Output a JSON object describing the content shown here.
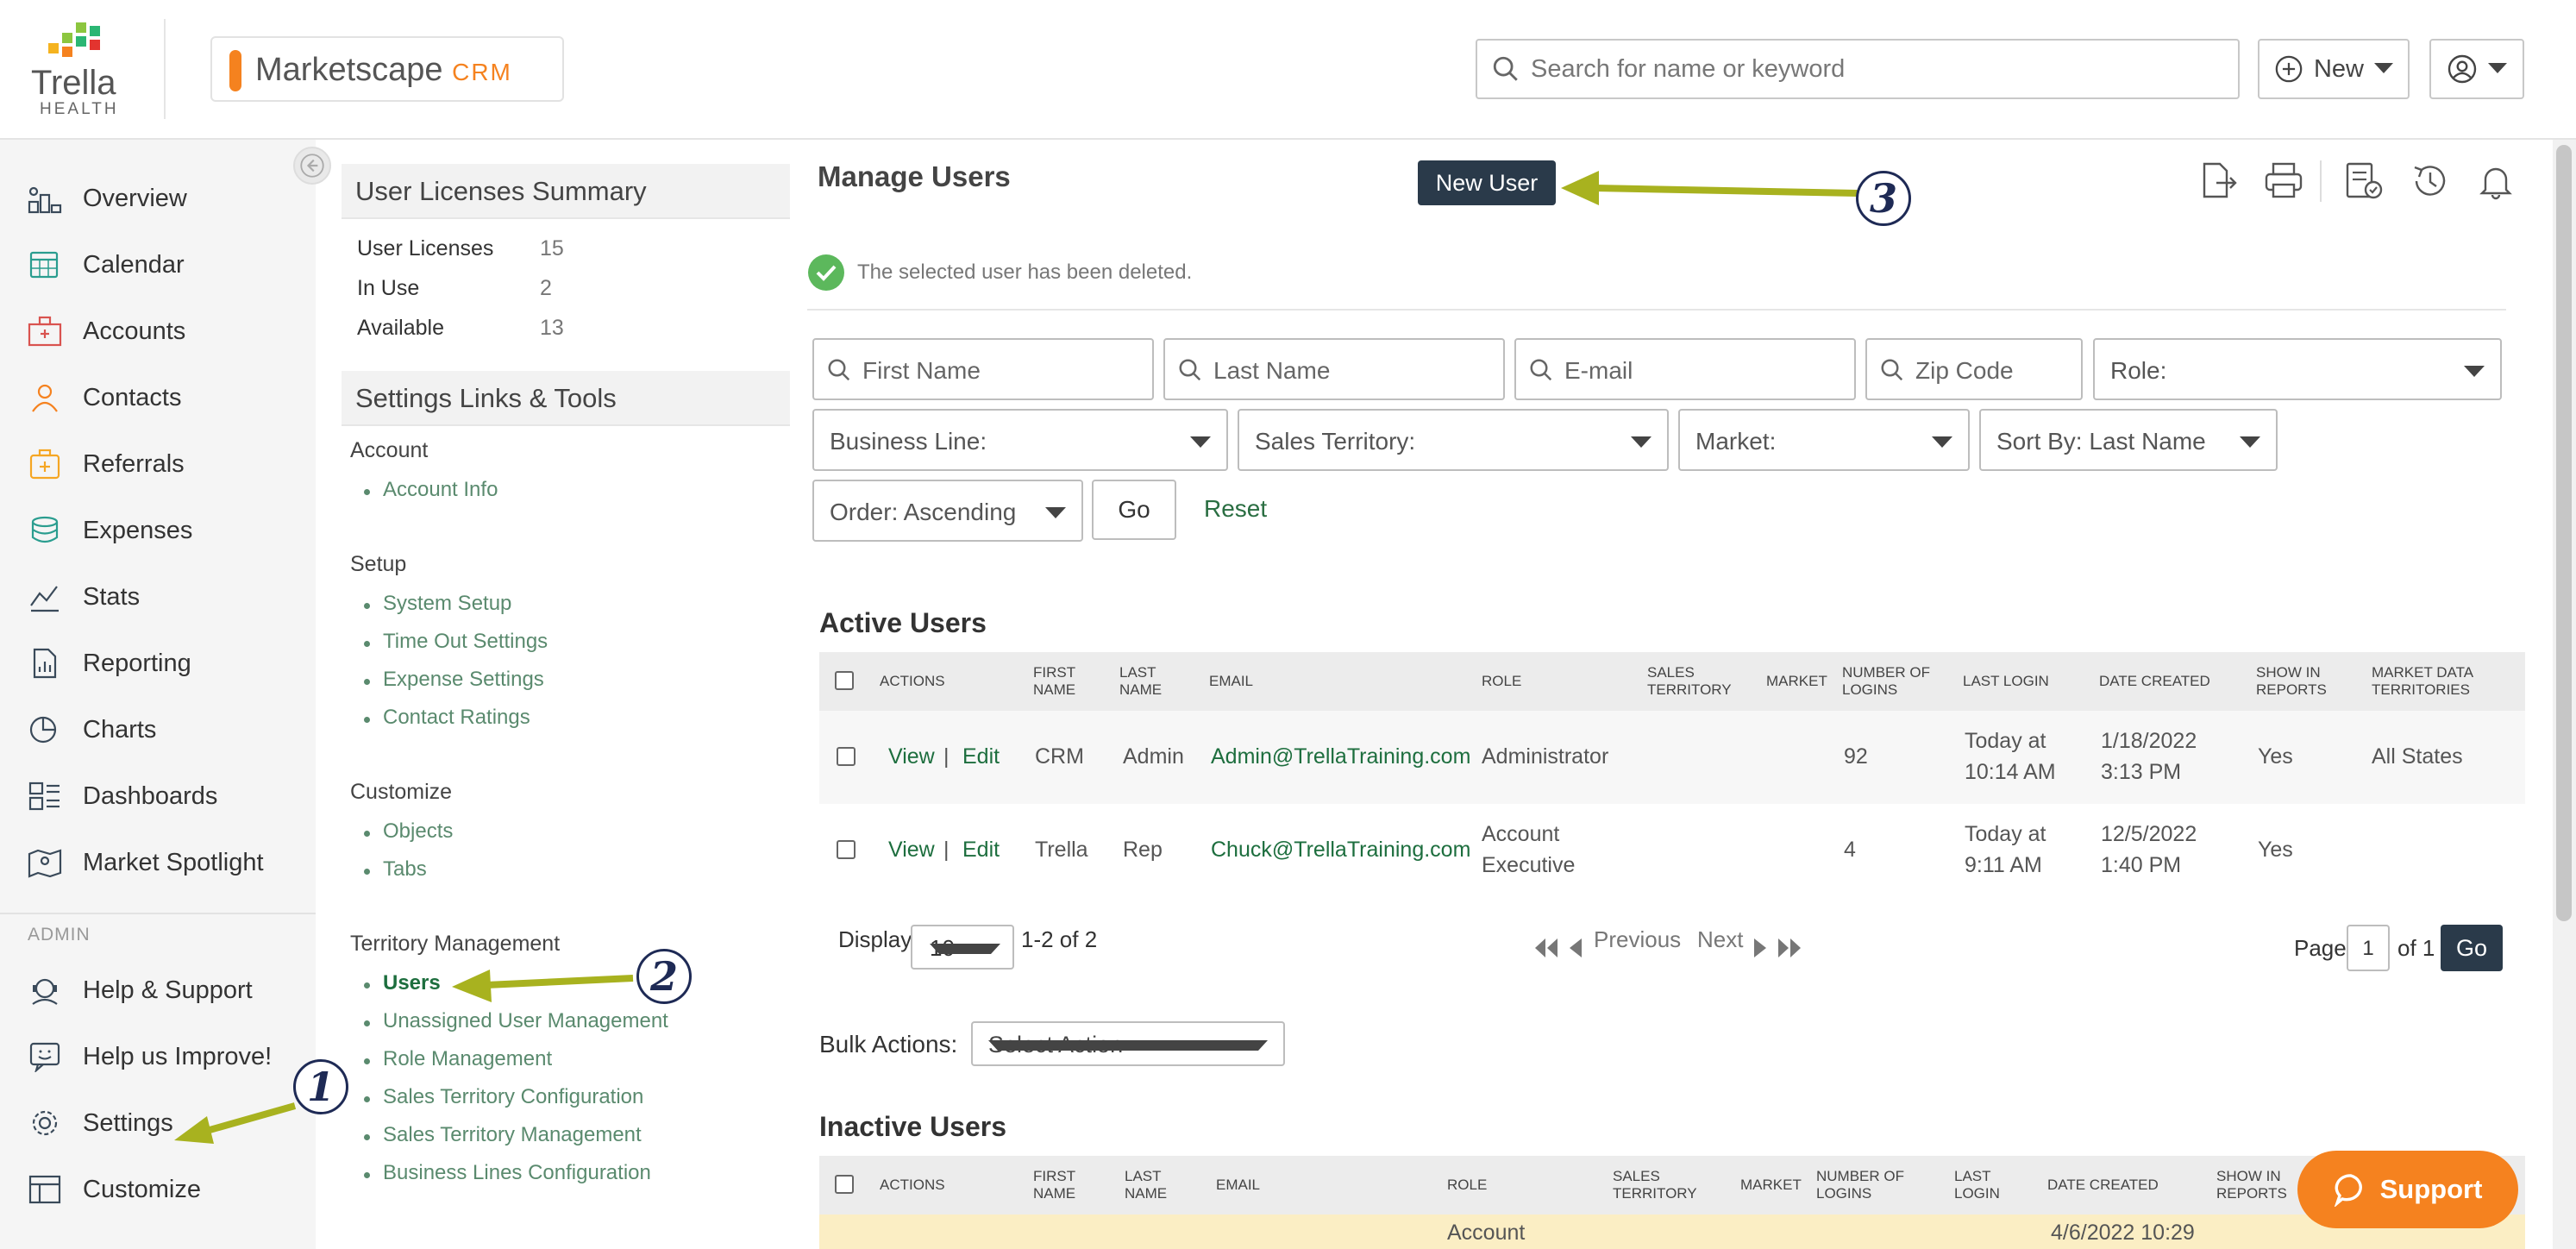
{
  "brand": {
    "logo_name": "Trella",
    "logo_sub": "HEALTH",
    "product": "Marketscape",
    "product_suffix": "CRM",
    "colors": {
      "accent": "#f5821f",
      "link": "#1d6e3e",
      "dark_button": "#2a3a4a"
    }
  },
  "header": {
    "search_placeholder": "Search for name or keyword",
    "new_label": "New"
  },
  "sidebar": {
    "items": [
      {
        "label": "Overview",
        "icon": "overview-icon"
      },
      {
        "label": "Calendar",
        "icon": "calendar-icon"
      },
      {
        "label": "Accounts",
        "icon": "accounts-icon"
      },
      {
        "label": "Contacts",
        "icon": "contacts-icon"
      },
      {
        "label": "Referrals",
        "icon": "referrals-icon"
      },
      {
        "label": "Expenses",
        "icon": "expenses-icon"
      },
      {
        "label": "Stats",
        "icon": "stats-icon"
      },
      {
        "label": "Reporting",
        "icon": "reporting-icon"
      },
      {
        "label": "Charts",
        "icon": "charts-icon"
      },
      {
        "label": "Dashboards",
        "icon": "dashboards-icon"
      },
      {
        "label": "Market Spotlight",
        "icon": "map-icon"
      }
    ],
    "admin_label": "ADMIN",
    "admin_items": [
      {
        "label": "Help & Support",
        "icon": "headset-icon"
      },
      {
        "label": "Help us Improve!",
        "icon": "feedback-icon"
      },
      {
        "label": "Settings",
        "icon": "gear-icon"
      },
      {
        "label": "Customize",
        "icon": "layout-icon"
      }
    ]
  },
  "licenses": {
    "title": "User Licenses Summary",
    "rows": [
      {
        "label": "User Licenses",
        "value": "15"
      },
      {
        "label": "In Use",
        "value": "2"
      },
      {
        "label": "Available",
        "value": "13"
      }
    ]
  },
  "settings_links": {
    "title": "Settings Links & Tools",
    "sections": [
      {
        "title": "Account",
        "links": [
          "Account Info"
        ]
      },
      {
        "title": "Setup",
        "links": [
          "System Setup",
          "Time Out Settings",
          "Expense Settings",
          "Contact Ratings"
        ]
      },
      {
        "title": "Customize",
        "links": [
          "Objects",
          "Tabs"
        ]
      },
      {
        "title": "Territory Management",
        "links": [
          "Users",
          "Unassigned User Management",
          "Role Management",
          "Sales Territory Configuration",
          "Sales Territory Management",
          "Business Lines Configuration"
        ]
      }
    ]
  },
  "main": {
    "title": "Manage Users",
    "new_user_label": "New User",
    "success_message": "The selected user has been deleted.",
    "filters": {
      "first_name": "First Name",
      "last_name": "Last Name",
      "email": "E-mail",
      "zip": "Zip Code",
      "role": "Role:",
      "business_line": "Business Line:",
      "sales_territory": "Sales Territory:",
      "market": "Market:",
      "sort_by": "Sort By:  Last Name",
      "order": "Order:  Ascending",
      "go": "Go",
      "reset": "Reset"
    }
  },
  "active_users": {
    "title": "Active Users",
    "headers": {
      "actions": "ACTIONS",
      "first_name": "FIRST NAME",
      "last_name": "LAST NAME",
      "email": "EMAIL",
      "role": "ROLE",
      "sales_territory": "SALES TERRITORY",
      "market": "MARKET",
      "logins": "NUMBER OF LOGINS",
      "last_login": "LAST LOGIN",
      "date_created": "DATE CREATED",
      "show_in_reports": "SHOW IN REPORTS",
      "market_data": "MARKET DATA TERRITORIES"
    },
    "view_label": "View",
    "edit_label": "Edit",
    "separator": "|",
    "rows": [
      {
        "first": "CRM",
        "last": "Admin",
        "email": "Admin@TrellaTraining.com",
        "role_1": "Administrator",
        "role_2": "",
        "logins": "92",
        "login_1": "Today at",
        "login_2": "10:14 AM",
        "created_1": "1/18/2022",
        "created_2": "3:13 PM",
        "reports": "Yes",
        "market_data": "All States"
      },
      {
        "first": "Trella",
        "last": "Rep",
        "email": "Chuck@TrellaTraining.com",
        "role_1": "Account",
        "role_2": "Executive",
        "logins": "4",
        "login_1": "Today at",
        "login_2": "9:11 AM",
        "created_1": "12/5/2022",
        "created_2": "1:40 PM",
        "reports": "Yes",
        "market_data": ""
      }
    ]
  },
  "pagination": {
    "display_label": "Display",
    "page_size": "10",
    "range": "1-2 of 2",
    "previous": "Previous",
    "next": "Next",
    "page_label": "Page",
    "page_value": "1",
    "of_label": "of 1",
    "go": "Go"
  },
  "bulk": {
    "label": "Bulk Actions:",
    "select": "Select Action"
  },
  "inactive_users": {
    "title": "Inactive Users",
    "headers": {
      "actions": "ACTIONS",
      "first_name": "FIRST NAME",
      "last_name": "LAST NAME",
      "email": "EMAIL",
      "role": "ROLE",
      "sales_territory": "SALES TERRITORY",
      "market": "MARKET",
      "logins": "NUMBER OF LOGINS",
      "last_login": "LAST LOGIN",
      "date_created": "DATE CREATED",
      "show_in_reports": "SHOW IN REPORTS"
    },
    "partial_row": {
      "role": "Account",
      "created": "4/6/2022 10:29"
    }
  },
  "support_label": "Support",
  "annotations": [
    "1",
    "2",
    "3"
  ]
}
